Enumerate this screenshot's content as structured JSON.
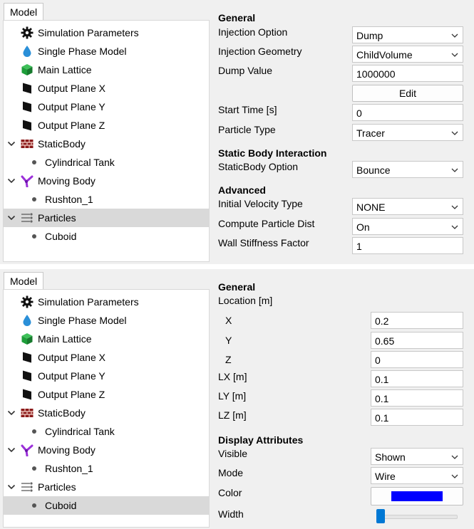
{
  "tab_label": "Model",
  "tree": [
    {
      "label": "Simulation Parameters",
      "icon": "gear-icon"
    },
    {
      "label": "Single Phase Model",
      "icon": "droplet-icon"
    },
    {
      "label": "Main Lattice",
      "icon": "cube-icon"
    },
    {
      "label": "Output Plane X",
      "icon": "plane-icon"
    },
    {
      "label": "Output Plane Y",
      "icon": "plane-icon"
    },
    {
      "label": "Output Plane Z",
      "icon": "plane-icon"
    },
    {
      "label": "StaticBody",
      "icon": "brick-wall-icon"
    },
    {
      "label": "Cylindrical Tank",
      "icon": "bullet-icon"
    },
    {
      "label": "Moving Body",
      "icon": "impeller-icon"
    },
    {
      "label": "Rushton_1",
      "icon": "bullet-icon"
    },
    {
      "label": "Particles",
      "icon": "particles-icon"
    },
    {
      "label": "Cuboid",
      "icon": "bullet-icon"
    }
  ],
  "panel1": {
    "selected_item": "Particles",
    "general_header": "General",
    "injection_option_label": "Injection Option",
    "injection_option_value": "Dump",
    "injection_geometry_label": "Injection Geometry",
    "injection_geometry_value": "ChildVolume",
    "dump_value_label": "Dump Value",
    "dump_value": "1000000",
    "edit_button": "Edit",
    "start_time_label": "Start Time [s]",
    "start_time_value": "0",
    "particle_type_label": "Particle Type",
    "particle_type_value": "Tracer",
    "static_body_header": "Static Body Interaction",
    "staticbody_option_label": "StaticBody Option",
    "staticbody_option_value": "Bounce",
    "advanced_header": "Advanced",
    "initial_velocity_label": "Initial Velocity Type",
    "initial_velocity_value": "NONE",
    "compute_particle_label": "Compute Particle Dist",
    "compute_particle_value": "On",
    "wall_stiffness_label": "Wall Stiffness Factor",
    "wall_stiffness_value": "1"
  },
  "panel2": {
    "selected_item": "Cuboid",
    "general_header": "General",
    "location_label": "Location [m]",
    "x_label": "X",
    "x_value": "0.2",
    "y_label": "Y",
    "y_value": "0.65",
    "z_label": "Z",
    "z_value": "0",
    "lx_label": "LX [m]",
    "lx_value": "0.1",
    "ly_label": "LY [m]",
    "ly_value": "0.1",
    "lz_label": "LZ [m]",
    "lz_value": "0.1",
    "display_header": "Display Attributes",
    "visible_label": "Visible",
    "visible_value": "Shown",
    "mode_label": "Mode",
    "mode_value": "Wire",
    "color_label": "Color",
    "color_value": "#0000ff",
    "width_label": "Width",
    "width_slider_fraction": 0.0
  },
  "colors": {
    "selection": "#d9d9d9",
    "accent": "#0078d4",
    "staticbody_icon": "#8b1a1a",
    "moving_body_icon": "#9b30d9",
    "lattice_icon": "#1e9e3a",
    "droplet_icon": "#2a8fd8"
  }
}
